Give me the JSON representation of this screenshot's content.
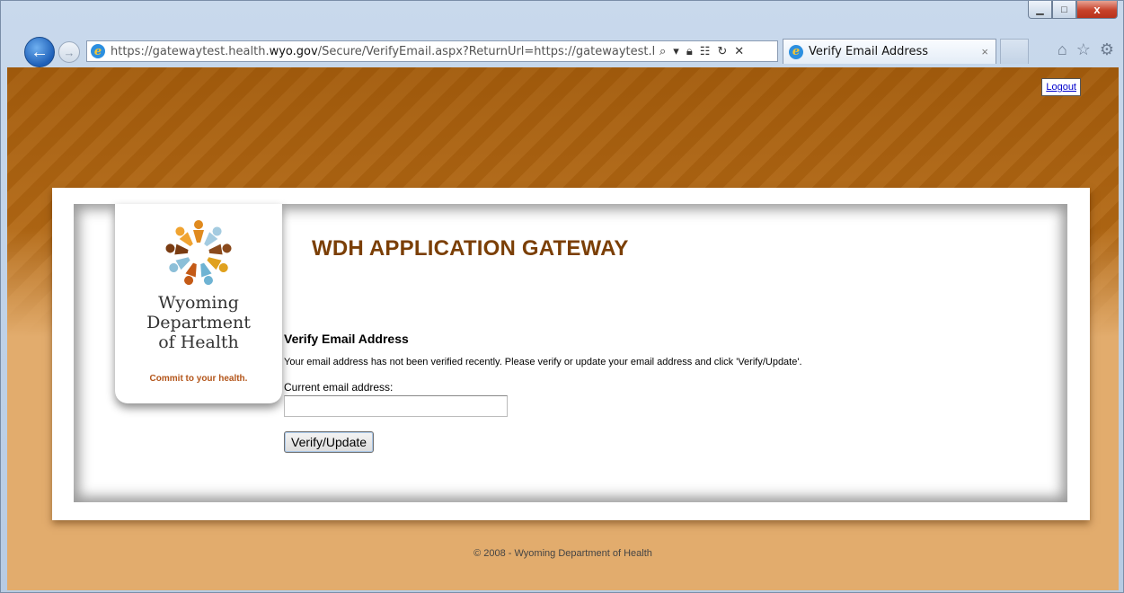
{
  "browser": {
    "url_prefix": "https://gatewaytest.health.",
    "url_domain": "wyo.gov",
    "url_suffix": "/Secure/VerifyEmail.aspx?ReturnUrl=https://gatewaytest.hea",
    "tab_title": "Verify Email Address",
    "tab_close": "×",
    "window_close": "x"
  },
  "page": {
    "logout_label": "Logout",
    "logo_line1": "Wyoming",
    "logo_line2": "Department",
    "logo_line3": "of Health",
    "logo_tagline": "Commit to your health.",
    "app_title": "WDH APPLICATION GATEWAY",
    "form_title": "Verify Email Address",
    "form_message": "Your email address has not been verified recently. Please verify or update your email address and click 'Verify/Update'.",
    "email_label": "Current email address:",
    "email_value": "",
    "verify_button": "Verify/Update",
    "footer": "© 2008 - Wyoming Department of Health"
  },
  "colors": {
    "title_brown": "#7b3f06",
    "band_dark": "#a8600f",
    "page_tan": "#e2ac6d",
    "tagline_orange": "#b3551a"
  }
}
